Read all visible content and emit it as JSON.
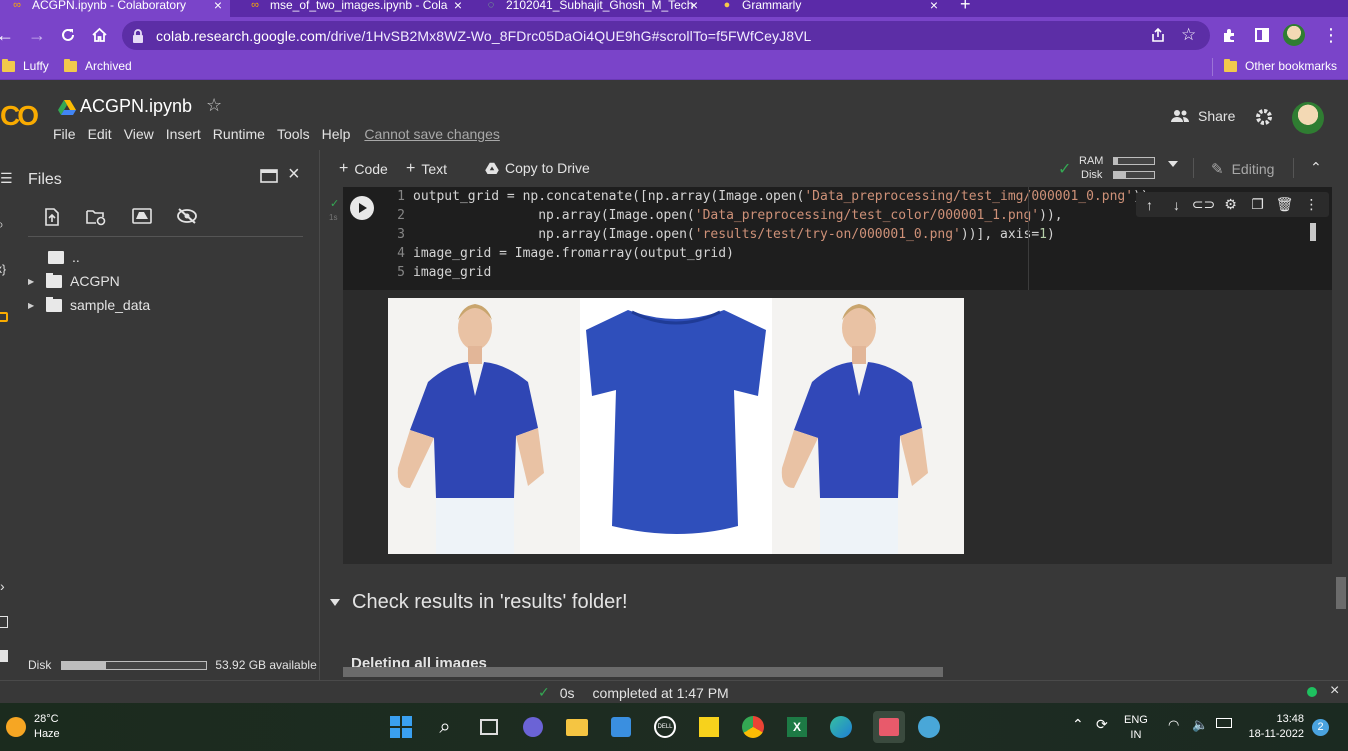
{
  "browser": {
    "tabs": [
      {
        "title": "ACGPN.ipynb - Colaboratory",
        "icon": "colab-icon"
      },
      {
        "title": "mse_of_two_images.ipynb - Cola",
        "icon": "colab-icon"
      },
      {
        "title": "2102041_Subhajit_Ghosh_M_Tech",
        "icon": "refresh-icon"
      },
      {
        "title": "Grammarly",
        "icon": "grammarly-icon"
      }
    ],
    "url_host": "colab.research.google.com",
    "url_path": "/drive/1HvSB2Mx8WZ-Wo_8FDrc05DaOi4QUE9hG#scrollTo=f5FWfCeyJ8VL",
    "bookmarks": [
      "Luffy",
      "Archived"
    ],
    "other_bookmarks": "Other bookmarks",
    "accent": "#7a44c9"
  },
  "colab": {
    "notebook_title": "ACGPN.ipynb",
    "menu": [
      "File",
      "Edit",
      "View",
      "Insert",
      "Runtime",
      "Tools",
      "Help"
    ],
    "cannot_save": "Cannot save changes",
    "share_label": "Share",
    "toolbar": {
      "code_label": "Code",
      "text_label": "Text",
      "copy_drive_label": "Copy to Drive",
      "ram_label": "RAM",
      "disk_label": "Disk",
      "ram_fraction": 0.1,
      "disk_fraction": 0.3,
      "editing_label": "Editing"
    }
  },
  "sidebar": {
    "title": "Files",
    "tree": [
      {
        "name": "..",
        "type": "parent"
      },
      {
        "name": "ACGPN",
        "type": "folder"
      },
      {
        "name": "sample_data",
        "type": "folder"
      }
    ],
    "disk_label": "Disk",
    "disk_available": "53.92 GB available",
    "disk_used_fraction": 0.3
  },
  "cell": {
    "exec_time": "1s",
    "lines": [
      {
        "n": "1"
      },
      {
        "n": "2"
      },
      {
        "n": "3"
      },
      {
        "n": "4"
      },
      {
        "n": "5"
      }
    ],
    "code": {
      "l1_a": "output_grid = np.concatenate([np.array(Image.open(",
      "l1_s": "'Data_preprocessing/test_img/000001_0.png'",
      "l1_b": "))",
      "l2_a": "                np.array(Image.open(",
      "l2_s": "'Data_preprocessing/test_color/000001_1.png'",
      "l2_b": ")),",
      "l3_a": "                np.array(Image.open(",
      "l3_s": "'results/test/try-on/000001_0.png'",
      "l3_b": "))], axis=",
      "l3_n": "1",
      "l3_c": ")",
      "l4": "image_grid = Image.fromarray(output_grid)",
      "l5": "image_grid"
    }
  },
  "sections": {
    "check_results": "Check results in 'results' folder!",
    "deleting": "Deleting all images"
  },
  "status": {
    "elapsed": "0s",
    "text": "completed at 1:47 PM"
  },
  "taskbar": {
    "temperature": "28°C",
    "condition": "Haze",
    "lang_top": "ENG",
    "lang_bottom": "IN",
    "time": "13:48",
    "date": "18-11-2022",
    "notifications": "2"
  }
}
